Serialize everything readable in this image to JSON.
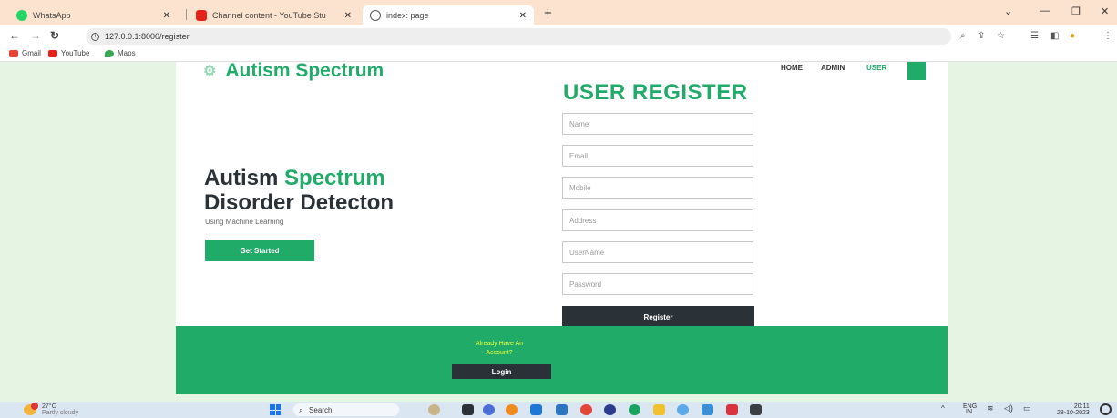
{
  "browser": {
    "tabs": [
      {
        "label": "WhatsApp",
        "active": false
      },
      {
        "label": "Channel content - YouTube Stu",
        "active": false
      },
      {
        "label": "index: page",
        "active": true
      }
    ],
    "new_tab_symbol": "+",
    "url": "127.0.0.1:8000/register",
    "bookmarks": [
      "Gmail",
      "YouTube",
      "Maps"
    ]
  },
  "site": {
    "logo_text": "Autism Spectrum",
    "nav": [
      "HOME",
      "ADMIN",
      "USER"
    ],
    "active_nav": "USER"
  },
  "hero": {
    "title_line1_part1": "Autism",
    "title_line1_part2": "Spectrum",
    "title_line2": "Disorder Detecton",
    "subtitle": "Using Machine Learning",
    "cta_label": "Get Started"
  },
  "register": {
    "title": "USER REGISTER",
    "fields": [
      {
        "placeholder": "Name"
      },
      {
        "placeholder": "Email"
      },
      {
        "placeholder": "Mobile"
      },
      {
        "placeholder": "Address"
      },
      {
        "placeholder": "UserName"
      },
      {
        "placeholder": "Password"
      }
    ],
    "submit_label": "Register"
  },
  "footer": {
    "prompt_line1": "Already Have An",
    "prompt_line2": "Account?",
    "login_label": "Login"
  },
  "taskbar": {
    "weather_temp": "27°C",
    "weather_desc": "Partly cloudy",
    "search_label": "Search",
    "lang_line1": "ENG",
    "lang_line2": "IN",
    "time": "20:11",
    "date": "28-10-2023"
  },
  "colors": {
    "accent": "#20ab68",
    "dark": "#2b3237",
    "page_bg": "#e6f5e3",
    "footer_text": "#eaff3a"
  }
}
